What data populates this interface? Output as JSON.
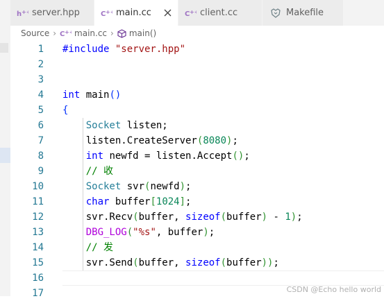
{
  "tabs": [
    {
      "label": "server.hpp",
      "icon": "h-file-icon",
      "active": false
    },
    {
      "label": "main.cc",
      "icon": "cpp-file-icon",
      "active": true
    },
    {
      "label": "client.cc",
      "icon": "cpp-file-icon",
      "active": false
    },
    {
      "label": "Makefile",
      "icon": "makefile-icon",
      "active": false
    }
  ],
  "breadcrumbs": {
    "folder": "Source",
    "file": "main.cc",
    "symbol": "main()"
  },
  "editor": {
    "lines": [
      {
        "num": "1",
        "tokens": [
          {
            "t": "#include ",
            "c": "pre"
          },
          {
            "t": "\"server.hpp\"",
            "c": "str"
          }
        ]
      },
      {
        "num": "2",
        "tokens": []
      },
      {
        "num": "3",
        "tokens": []
      },
      {
        "num": "4",
        "tokens": [
          {
            "t": "int",
            "c": "kw"
          },
          {
            "t": " main",
            "c": "plain"
          },
          {
            "t": "()",
            "c": "br1"
          }
        ]
      },
      {
        "num": "5",
        "tokens": [
          {
            "t": "{",
            "c": "br1"
          }
        ]
      },
      {
        "num": "6",
        "indent": true,
        "tokens": [
          {
            "t": "    ",
            "c": "plain"
          },
          {
            "t": "Socket",
            "c": "type"
          },
          {
            "t": " listen;",
            "c": "plain"
          }
        ]
      },
      {
        "num": "7",
        "indent": true,
        "tokens": [
          {
            "t": "    listen.CreateServer",
            "c": "plain"
          },
          {
            "t": "(",
            "c": "br2"
          },
          {
            "t": "8080",
            "c": "num"
          },
          {
            "t": ")",
            "c": "br2"
          },
          {
            "t": ";",
            "c": "plain"
          }
        ]
      },
      {
        "num": "8",
        "indent": true,
        "tokens": [
          {
            "t": "    ",
            "c": "plain"
          },
          {
            "t": "int",
            "c": "kw"
          },
          {
            "t": " newfd = listen.Accept",
            "c": "plain"
          },
          {
            "t": "()",
            "c": "br2"
          },
          {
            "t": ";",
            "c": "plain"
          }
        ]
      },
      {
        "num": "9",
        "indent": true,
        "tokens": [
          {
            "t": "    ",
            "c": "plain"
          },
          {
            "t": "// 收",
            "c": "com"
          }
        ]
      },
      {
        "num": "10",
        "indent": true,
        "tokens": [
          {
            "t": "    ",
            "c": "plain"
          },
          {
            "t": "Socket",
            "c": "type"
          },
          {
            "t": " svr",
            "c": "plain"
          },
          {
            "t": "(",
            "c": "br2"
          },
          {
            "t": "newfd",
            "c": "plain"
          },
          {
            "t": ")",
            "c": "br2"
          },
          {
            "t": ";",
            "c": "plain"
          }
        ]
      },
      {
        "num": "11",
        "indent": true,
        "tokens": [
          {
            "t": "    ",
            "c": "plain"
          },
          {
            "t": "char",
            "c": "kw"
          },
          {
            "t": " buffer",
            "c": "plain"
          },
          {
            "t": "[",
            "c": "br2"
          },
          {
            "t": "1024",
            "c": "num"
          },
          {
            "t": "]",
            "c": "br2"
          },
          {
            "t": ";",
            "c": "plain"
          }
        ]
      },
      {
        "num": "12",
        "indent": true,
        "tokens": [
          {
            "t": "    svr.Recv",
            "c": "plain"
          },
          {
            "t": "(",
            "c": "br2"
          },
          {
            "t": "buffer, ",
            "c": "plain"
          },
          {
            "t": "sizeof",
            "c": "kw"
          },
          {
            "t": "(",
            "c": "br2"
          },
          {
            "t": "buffer",
            "c": "plain"
          },
          {
            "t": ")",
            "c": "br2"
          },
          {
            "t": " - ",
            "c": "plain"
          },
          {
            "t": "1",
            "c": "num"
          },
          {
            "t": ")",
            "c": "br2"
          },
          {
            "t": ";",
            "c": "plain"
          }
        ]
      },
      {
        "num": "13",
        "indent": true,
        "tokens": [
          {
            "t": "    ",
            "c": "plain"
          },
          {
            "t": "DBG_LOG",
            "c": "macro"
          },
          {
            "t": "(",
            "c": "br2"
          },
          {
            "t": "\"%s\"",
            "c": "str"
          },
          {
            "t": ", buffer",
            "c": "plain"
          },
          {
            "t": ")",
            "c": "br2"
          },
          {
            "t": ";",
            "c": "plain"
          }
        ]
      },
      {
        "num": "14",
        "indent": true,
        "tokens": [
          {
            "t": "    ",
            "c": "plain"
          },
          {
            "t": "// 发",
            "c": "com"
          }
        ]
      },
      {
        "num": "15",
        "indent": true,
        "tokens": [
          {
            "t": "    svr.Send",
            "c": "plain"
          },
          {
            "t": "(",
            "c": "br2"
          },
          {
            "t": "buffer, ",
            "c": "plain"
          },
          {
            "t": "sizeof",
            "c": "kw"
          },
          {
            "t": "(",
            "c": "br2"
          },
          {
            "t": "buffer",
            "c": "plain"
          },
          {
            "t": "))",
            "c": "br2"
          },
          {
            "t": ";",
            "c": "plain"
          }
        ]
      },
      {
        "num": "16",
        "current": true,
        "tokens": []
      },
      {
        "num": "17",
        "tokens": []
      }
    ]
  },
  "watermark": "CSDN @Echo hello world",
  "colors": {
    "keyword": "#0000ff",
    "type": "#267f99",
    "string": "#a31515",
    "number": "#098658",
    "comment": "#008000",
    "macro": "#af00db",
    "line_number": "#237893",
    "close_icon": "#424242"
  }
}
